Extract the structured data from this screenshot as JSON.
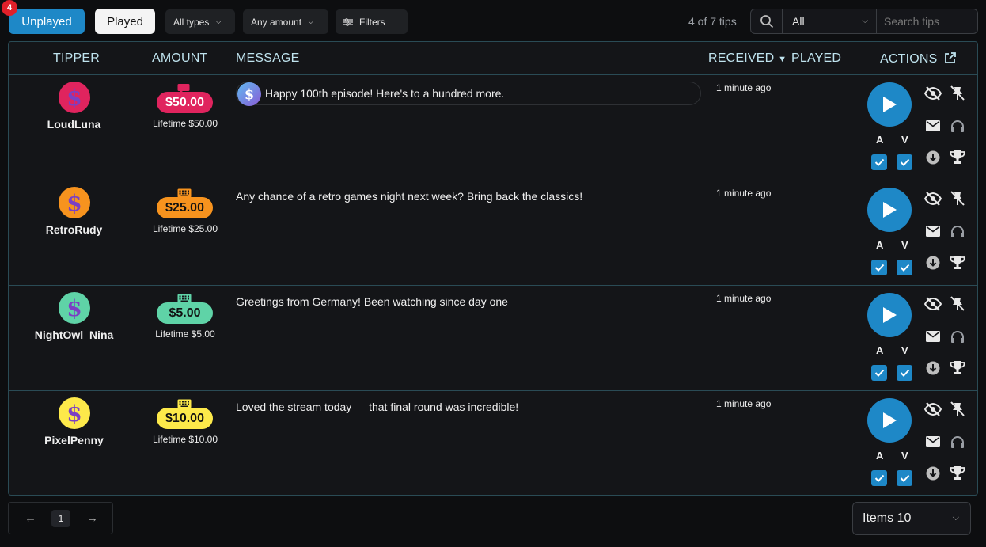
{
  "toolbar": {
    "unplayed_label": "Unplayed",
    "unplayed_badge": "4",
    "played_label": "Played",
    "types_filter": "All types",
    "amount_filter": "Any amount",
    "filters_label": "Filters",
    "tip_count": "4 of 7 tips",
    "search_scope": "All",
    "search_placeholder": "Search tips"
  },
  "table": {
    "headers": {
      "tipper": "TIPPER",
      "amount": "AMOUNT",
      "message": "MESSAGE",
      "received": "RECEIVED",
      "played": "PLAYED",
      "actions": "ACTIONS"
    },
    "av_labels": {
      "a": "A",
      "v": "V"
    },
    "rows": [
      {
        "name": "LoudLuna",
        "avatar_color": "#e0245e",
        "amount": "$50.00",
        "pill_color": "#e0245e",
        "pill_text_color": "#ffffff",
        "type_icon": "chat-icon",
        "type_icon_color": "#e0245e",
        "lifetime": "Lifetime $50.00",
        "message": "Happy 100th episode! Here's to a hundred more.",
        "has_bubble": true,
        "received": "1 minute ago"
      },
      {
        "name": "RetroRudy",
        "avatar_color": "#f7931e",
        "amount": "$25.00",
        "pill_color": "#f7931e",
        "pill_text_color": "#111111",
        "type_icon": "keyboard-icon",
        "type_icon_color": "#f7931e",
        "lifetime": "Lifetime $25.00",
        "message": "Any chance of a retro games night next week? Bring back the classics!",
        "has_bubble": false,
        "received": "1 minute ago"
      },
      {
        "name": "NightOwl_Nina",
        "avatar_color": "#5fd3a7",
        "amount": "$5.00",
        "pill_color": "#5fd3a7",
        "pill_text_color": "#111111",
        "type_icon": "keyboard-icon",
        "type_icon_color": "#5fd3a7",
        "lifetime": "Lifetime $5.00",
        "message": "Greetings from Germany! Been watching since day one",
        "has_bubble": false,
        "received": "1 minute ago"
      },
      {
        "name": "PixelPenny",
        "avatar_color": "#fde94a",
        "amount": "$10.00",
        "pill_color": "#fde94a",
        "pill_text_color": "#111111",
        "type_icon": "keyboard-icon",
        "type_icon_color": "#fde94a",
        "lifetime": "Lifetime $10.00",
        "message": "Loved the stream today — that final round was incredible!",
        "has_bubble": false,
        "received": "1 minute ago"
      }
    ]
  },
  "pagination": {
    "current_page": "1",
    "prev": "←",
    "next": "→"
  },
  "page_size": "Items 10"
}
